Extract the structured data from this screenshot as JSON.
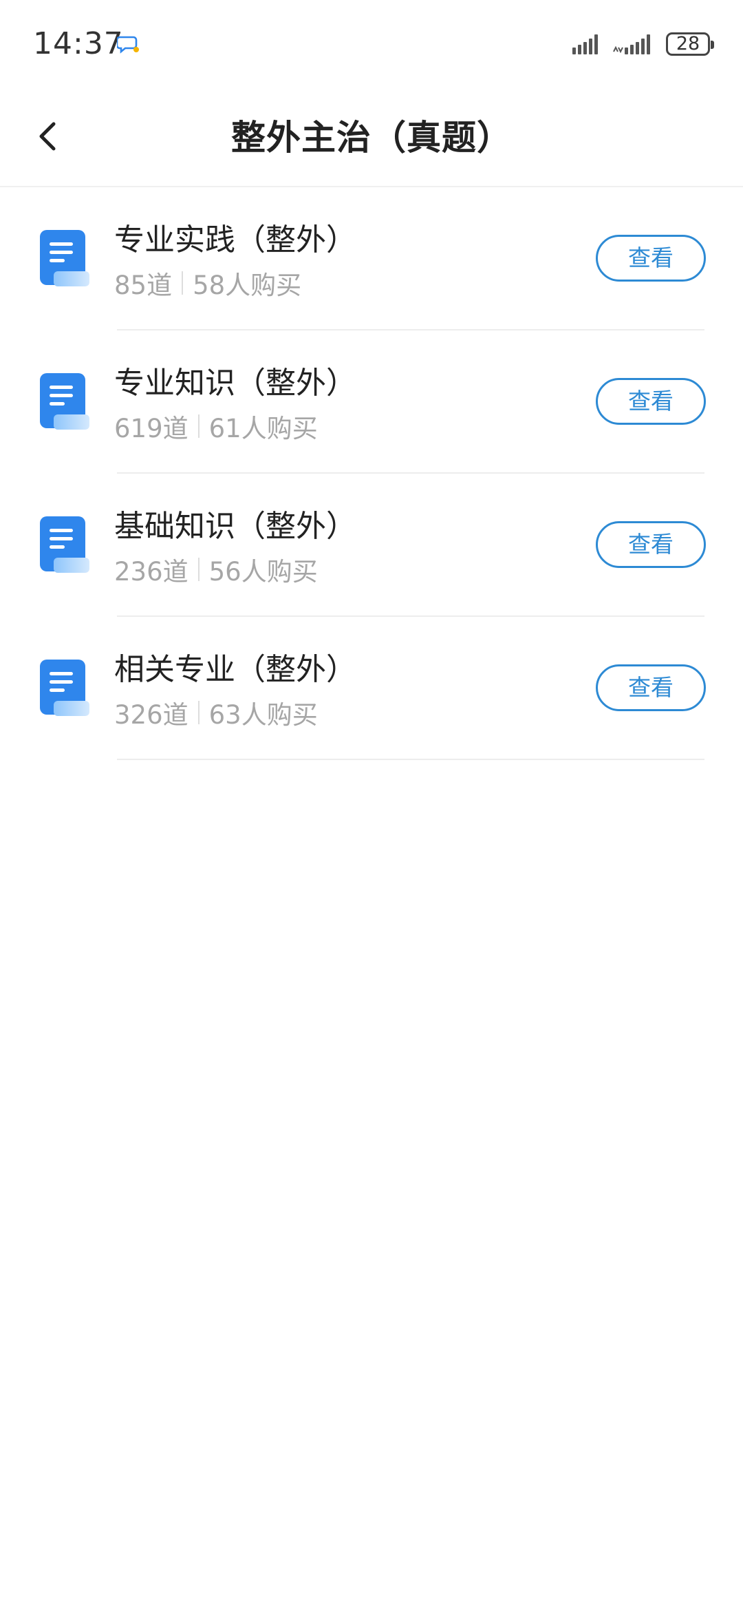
{
  "status_bar": {
    "time": "14:37",
    "battery": "28"
  },
  "nav": {
    "title": "整外主治（真题）"
  },
  "items": [
    {
      "title": "专业实践（整外）",
      "count": "85道",
      "buyers": "58人购买",
      "button": "查看"
    },
    {
      "title": "专业知识（整外）",
      "count": "619道",
      "buyers": "61人购买",
      "button": "查看"
    },
    {
      "title": "基础知识（整外）",
      "count": "236道",
      "buyers": "56人购买",
      "button": "查看"
    },
    {
      "title": "相关专业（整外）",
      "count": "326道",
      "buyers": "63人购买",
      "button": "查看"
    }
  ],
  "colors": {
    "accent": "#2d8ad4",
    "icon_blue": "#2f86ec",
    "title_text": "#222222",
    "meta_text": "#a6a6a6"
  },
  "icons": {
    "back": "chevron-left-icon",
    "item": "document-icon",
    "status_chat": "chat-bubble-icon",
    "signal": "signal-icon",
    "battery": "battery-icon"
  }
}
